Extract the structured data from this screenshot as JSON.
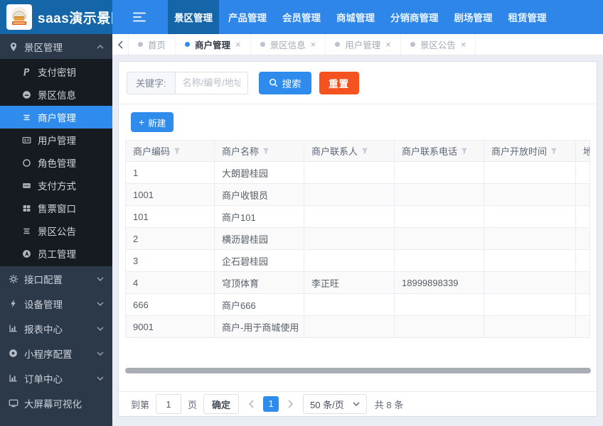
{
  "topbar": {
    "title": "saas演示景区",
    "nav_items": [
      {
        "label": "景区管理",
        "active": true
      },
      {
        "label": "产品管理",
        "active": false
      },
      {
        "label": "会员管理",
        "active": false
      },
      {
        "label": "商城管理",
        "active": false
      },
      {
        "label": "分销商管理",
        "active": false
      },
      {
        "label": "剧场管理",
        "active": false
      },
      {
        "label": "租赁管理",
        "active": false
      }
    ]
  },
  "sidebar": {
    "items": [
      {
        "label": "景区管理",
        "type": "group-expanded"
      },
      {
        "label": "支付密钥",
        "type": "submenu"
      },
      {
        "label": "景区信息",
        "type": "submenu"
      },
      {
        "label": "商户管理",
        "type": "submenu",
        "active": true
      },
      {
        "label": "用户管理",
        "type": "submenu"
      },
      {
        "label": "角色管理",
        "type": "submenu"
      },
      {
        "label": "支付方式",
        "type": "submenu"
      },
      {
        "label": "售票窗口",
        "type": "submenu"
      },
      {
        "label": "景区公告",
        "type": "submenu"
      },
      {
        "label": "员工管理",
        "type": "submenu"
      },
      {
        "label": "接口配置",
        "type": "group-collapsed"
      },
      {
        "label": "设备管理",
        "type": "group-collapsed"
      },
      {
        "label": "报表中心",
        "type": "group-collapsed"
      },
      {
        "label": "小程序配置",
        "type": "group-collapsed"
      },
      {
        "label": "订单中心",
        "type": "group-collapsed"
      },
      {
        "label": "大屏幕可视化",
        "type": "single"
      }
    ]
  },
  "tabs": [
    {
      "label": "首页",
      "active": false,
      "closable": false
    },
    {
      "label": "商户管理",
      "active": true,
      "closable": true
    },
    {
      "label": "景区信息",
      "active": false,
      "closable": true
    },
    {
      "label": "用户管理",
      "active": false,
      "closable": true
    },
    {
      "label": "景区公告",
      "active": false,
      "closable": true
    }
  ],
  "search": {
    "label": "关键字:",
    "placeholder": "名称/编号/地址",
    "search_button": "搜索",
    "reset_button": "重置"
  },
  "toolbar": {
    "new_button": "新建"
  },
  "table": {
    "columns": [
      "商户编码",
      "商户名称",
      "商户联系人",
      "商户联系电话",
      "商户开放时间",
      "地址"
    ],
    "rows": [
      [
        "1",
        "大朗碧桂园",
        "",
        "",
        "",
        ""
      ],
      [
        "1001",
        "商户收银员",
        "",
        "",
        "",
        ""
      ],
      [
        "101",
        "商户101",
        "",
        "",
        "",
        ""
      ],
      [
        "2",
        "横沥碧桂园",
        "",
        "",
        "",
        ""
      ],
      [
        "3",
        "企石碧桂园",
        "",
        "",
        "",
        ""
      ],
      [
        "4",
        "穹顶体育",
        "李正旺",
        "18999898339",
        "",
        ""
      ],
      [
        "666",
        "商户666",
        "",
        "",
        "",
        ""
      ],
      [
        "9001",
        "商户-用于商城使用",
        "",
        "",
        "",
        ""
      ]
    ]
  },
  "pagination": {
    "goto_label": "到第",
    "goto_value": "1",
    "page_unit": "页",
    "confirm_button": "确定",
    "current_page": "1",
    "page_size_option": "50 条/页",
    "total_text": "共 8 条"
  },
  "colors": {
    "topnav_blue": "#2e87e8",
    "dark_blue": "#1566a8",
    "primary_blue": "#2f8ced",
    "reset_orange": "#f4521e",
    "sidebar_dark": "#2c3949",
    "submenu_dark": "#161a21",
    "content_bg": "#eaeef4"
  }
}
